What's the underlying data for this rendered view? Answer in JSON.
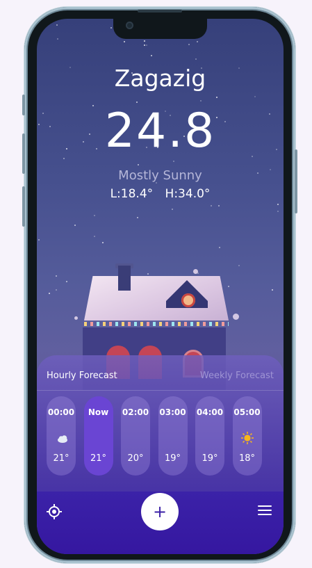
{
  "location": {
    "city": "Zagazig",
    "temperature": "24.8",
    "condition": "Mostly Sunny",
    "low": "L:18.4°",
    "high": "H:34.0°"
  },
  "forecast": {
    "tabs": {
      "hourly": "Hourly Forecast",
      "weekly": "Weekly Forecast"
    },
    "hours": [
      {
        "time": "00:00",
        "icon": "cloud-moon-icon",
        "temp": "21°",
        "active": false
      },
      {
        "time": "Now",
        "icon": "moon-icon",
        "temp": "21°",
        "active": true
      },
      {
        "time": "02:00",
        "icon": "moon-icon",
        "temp": "20°",
        "active": false
      },
      {
        "time": "03:00",
        "icon": "moon-icon",
        "temp": "19°",
        "active": false
      },
      {
        "time": "04:00",
        "icon": "moon-icon",
        "temp": "19°",
        "active": false
      },
      {
        "time": "05:00",
        "icon": "sun-icon",
        "temp": "18°",
        "active": false
      }
    ]
  },
  "toolbar": {
    "location_icon": "crosshair-icon",
    "add_label": "+",
    "menu_icon": "menu-icon"
  },
  "colors": {
    "panel": "#4a36a8",
    "active_card": "#6a45d3",
    "bottom_bar": "#3517a0"
  }
}
